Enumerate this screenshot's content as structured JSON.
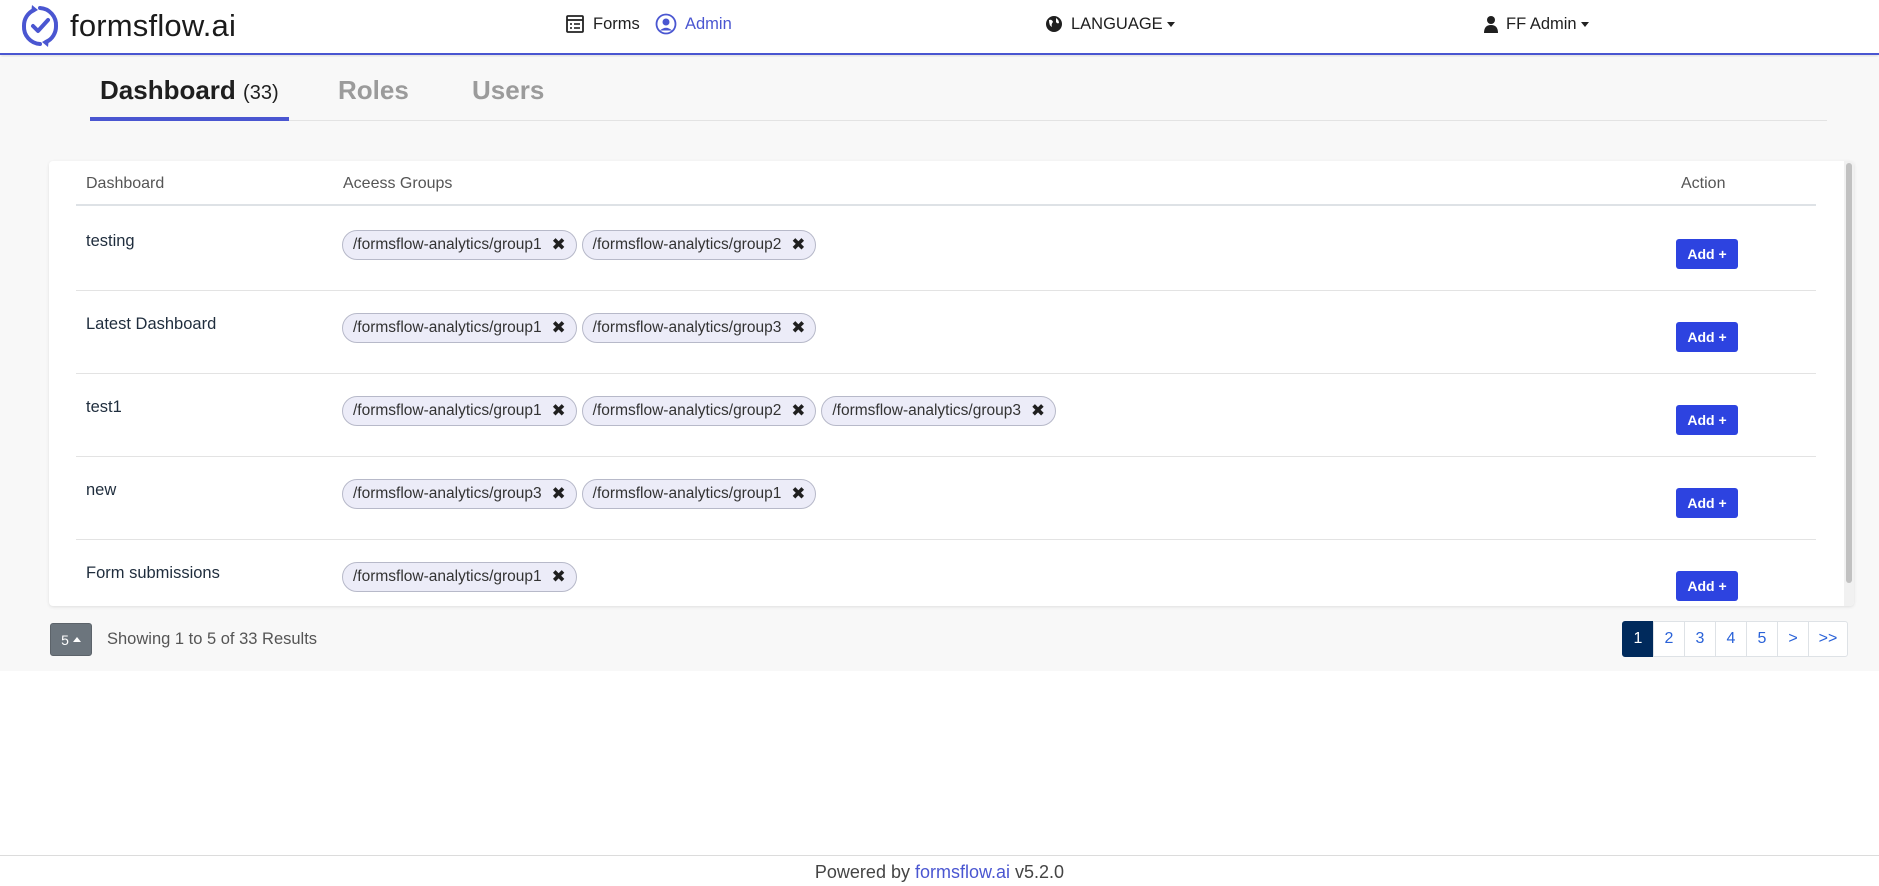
{
  "brand": {
    "name": "formsflow.ai"
  },
  "nav": {
    "forms": "Forms",
    "admin": "Admin",
    "language": "LANGUAGE",
    "user": "FF Admin"
  },
  "tabs": {
    "dashboard": "Dashboard",
    "dashboard_count": "(33)",
    "roles": "Roles",
    "users": "Users"
  },
  "table": {
    "headers": {
      "dashboard": "Dashboard",
      "groups": "Aceess Groups",
      "action": "Action"
    },
    "add_label": "Add +",
    "rows": [
      {
        "name": "testing",
        "groups": [
          "/formsflow-analytics/group1",
          "/formsflow-analytics/group2"
        ]
      },
      {
        "name": "Latest Dashboard",
        "groups": [
          "/formsflow-analytics/group1",
          "/formsflow-analytics/group3"
        ]
      },
      {
        "name": "test1",
        "groups": [
          "/formsflow-analytics/group1",
          "/formsflow-analytics/group2",
          "/formsflow-analytics/group3"
        ]
      },
      {
        "name": "new",
        "groups": [
          "/formsflow-analytics/group3",
          "/formsflow-analytics/group1"
        ]
      },
      {
        "name": "Form submissions",
        "groups": [
          "/formsflow-analytics/group1"
        ]
      }
    ]
  },
  "pagination": {
    "page_size": "5",
    "showing": "Showing 1 to 5 of 33 Results",
    "pages": [
      "1",
      "2",
      "3",
      "4",
      "5",
      ">",
      ">>"
    ],
    "active": "1"
  },
  "footer": {
    "prefix": "Powered by",
    "link": "formsflow.ai",
    "version": "v5.2.0"
  },
  "colors": {
    "accent": "#4a56d1",
    "button": "#2d43e0",
    "active_page": "#002a5c"
  }
}
